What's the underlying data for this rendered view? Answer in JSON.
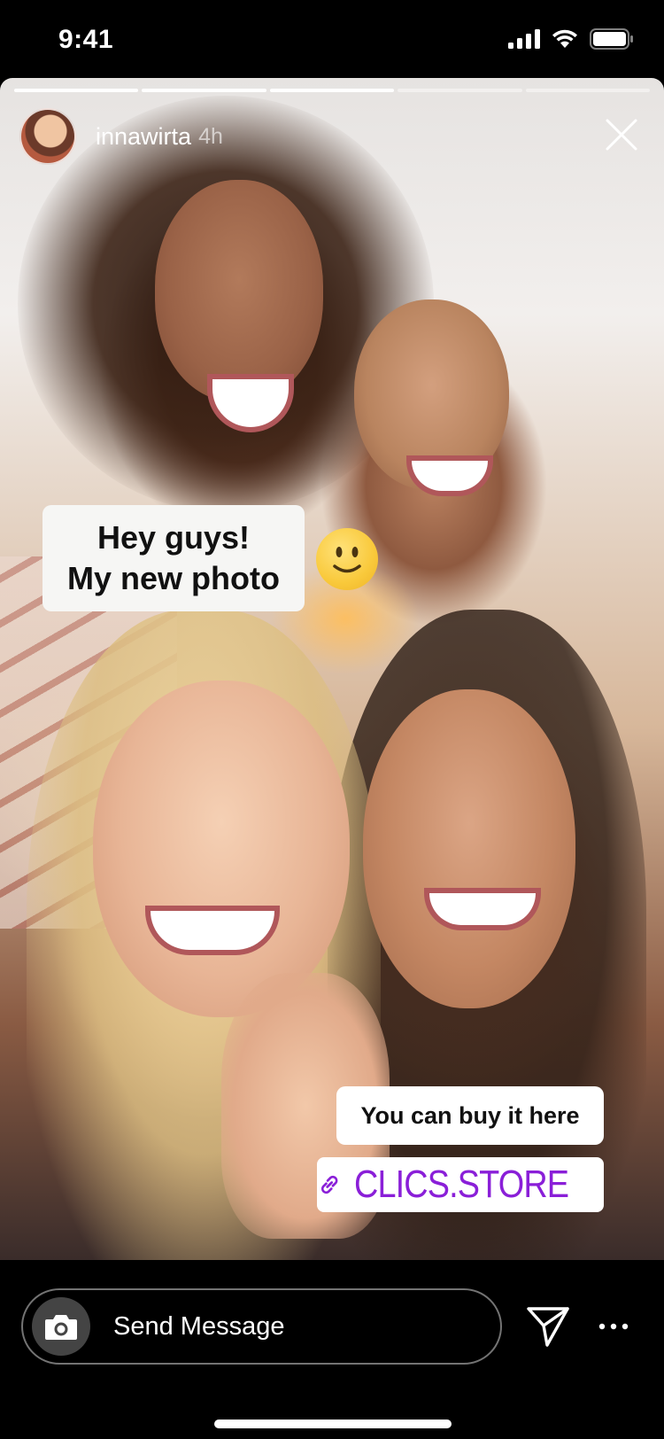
{
  "status_bar": {
    "time": "9:41",
    "icons": [
      "cellular-signal-icon",
      "wifi-icon",
      "battery-icon"
    ]
  },
  "story": {
    "progress": [
      1,
      1,
      1,
      0,
      0
    ],
    "user": {
      "username": "innawirta",
      "time_ago": "4h"
    },
    "close_icon": "close-icon"
  },
  "stickers": {
    "caption_line1": "Hey guys!",
    "caption_line2": "My new photo",
    "emoji": "slightly-smiling-face",
    "buy_text": "You can buy it here",
    "link_icon": "link-icon",
    "link_text": "CLICS.STORE",
    "link_color": "#8a1fd8"
  },
  "composer": {
    "camera_icon": "camera-icon",
    "placeholder": "Send Message",
    "send_icon": "send-icon",
    "more_icon": "more-icon"
  }
}
